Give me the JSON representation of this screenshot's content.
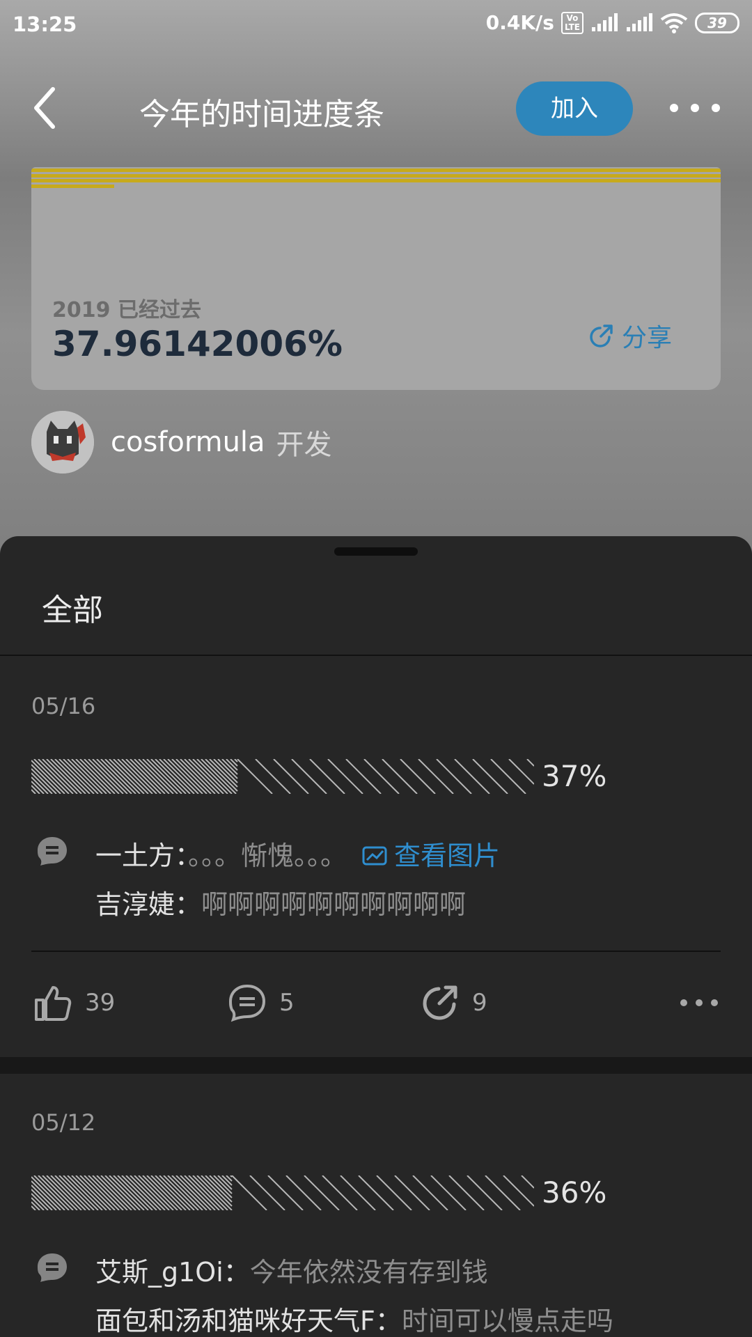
{
  "status_bar": {
    "time": "13:25",
    "speed": "0.4K/s",
    "volte": "Vo LTE",
    "battery": "39"
  },
  "header": {
    "title": "今年的时间进度条",
    "join_label": "加入"
  },
  "card": {
    "subtitle": "2019 已经过去",
    "percent_text": "37.96142006%",
    "progress_fraction": 0.3796,
    "share_label": "分享",
    "accent_color": "#c7aa1c"
  },
  "author": {
    "name": "cosformula",
    "role": "开发"
  },
  "sheet": {
    "tab_label": "全部"
  },
  "posts": [
    {
      "date": "05/16",
      "percent_label": "37%",
      "progress_fraction": 0.37,
      "comments": [
        {
          "user": "一土方：",
          "text": "。。。惭愧。。。",
          "link": "查看图片"
        },
        {
          "user": "吉淳婕：",
          "text": "啊啊啊啊啊啊啊啊啊啊"
        }
      ],
      "likes": "39",
      "comments_count": "5",
      "shares": "9"
    },
    {
      "date": "05/12",
      "percent_label": "36%",
      "progress_fraction": 0.36,
      "comments": [
        {
          "user": "艾斯_g1Oi：",
          "text": "今年依然没有存到钱"
        },
        {
          "user": "面包和汤和猫咪好天气F：",
          "text": "时间可以慢点走吗"
        }
      ]
    }
  ],
  "colors": {
    "join_button": "#2d86bb",
    "link": "#2f8ecf",
    "sheet_background": "#262626"
  },
  "icons": [
    "back-arrow-icon",
    "more-dots-icon",
    "share-icon",
    "comment-icon",
    "image-icon",
    "thumb-up-icon",
    "repost-icon"
  ]
}
